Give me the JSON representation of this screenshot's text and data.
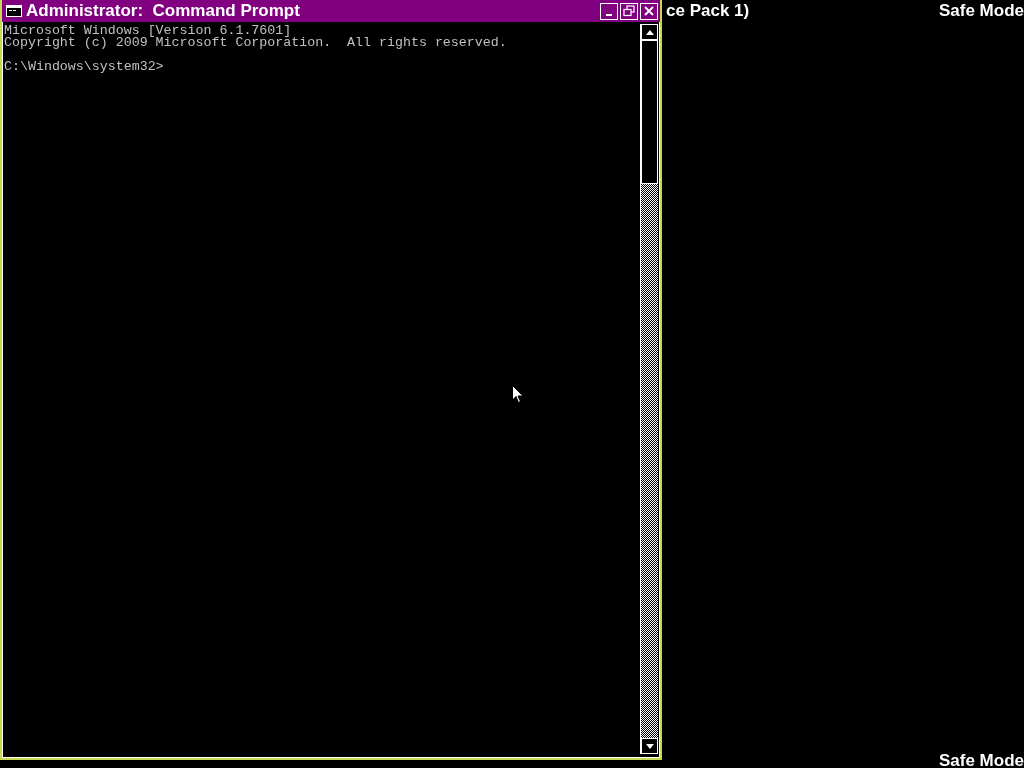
{
  "window": {
    "title": "Administrator:  Command Prompt",
    "console_lines": [
      "Microsoft Windows [Version 6.1.7601]",
      "Copyright (c) 2009 Microsoft Corporation.  All rights reserved."
    ],
    "prompt": "C:\\Windows\\system32>"
  },
  "desktop": {
    "banner": "ce Pack 1)",
    "safe_mode_top_right": "Safe Mode",
    "safe_mode_bottom_right": "Safe Mode"
  }
}
